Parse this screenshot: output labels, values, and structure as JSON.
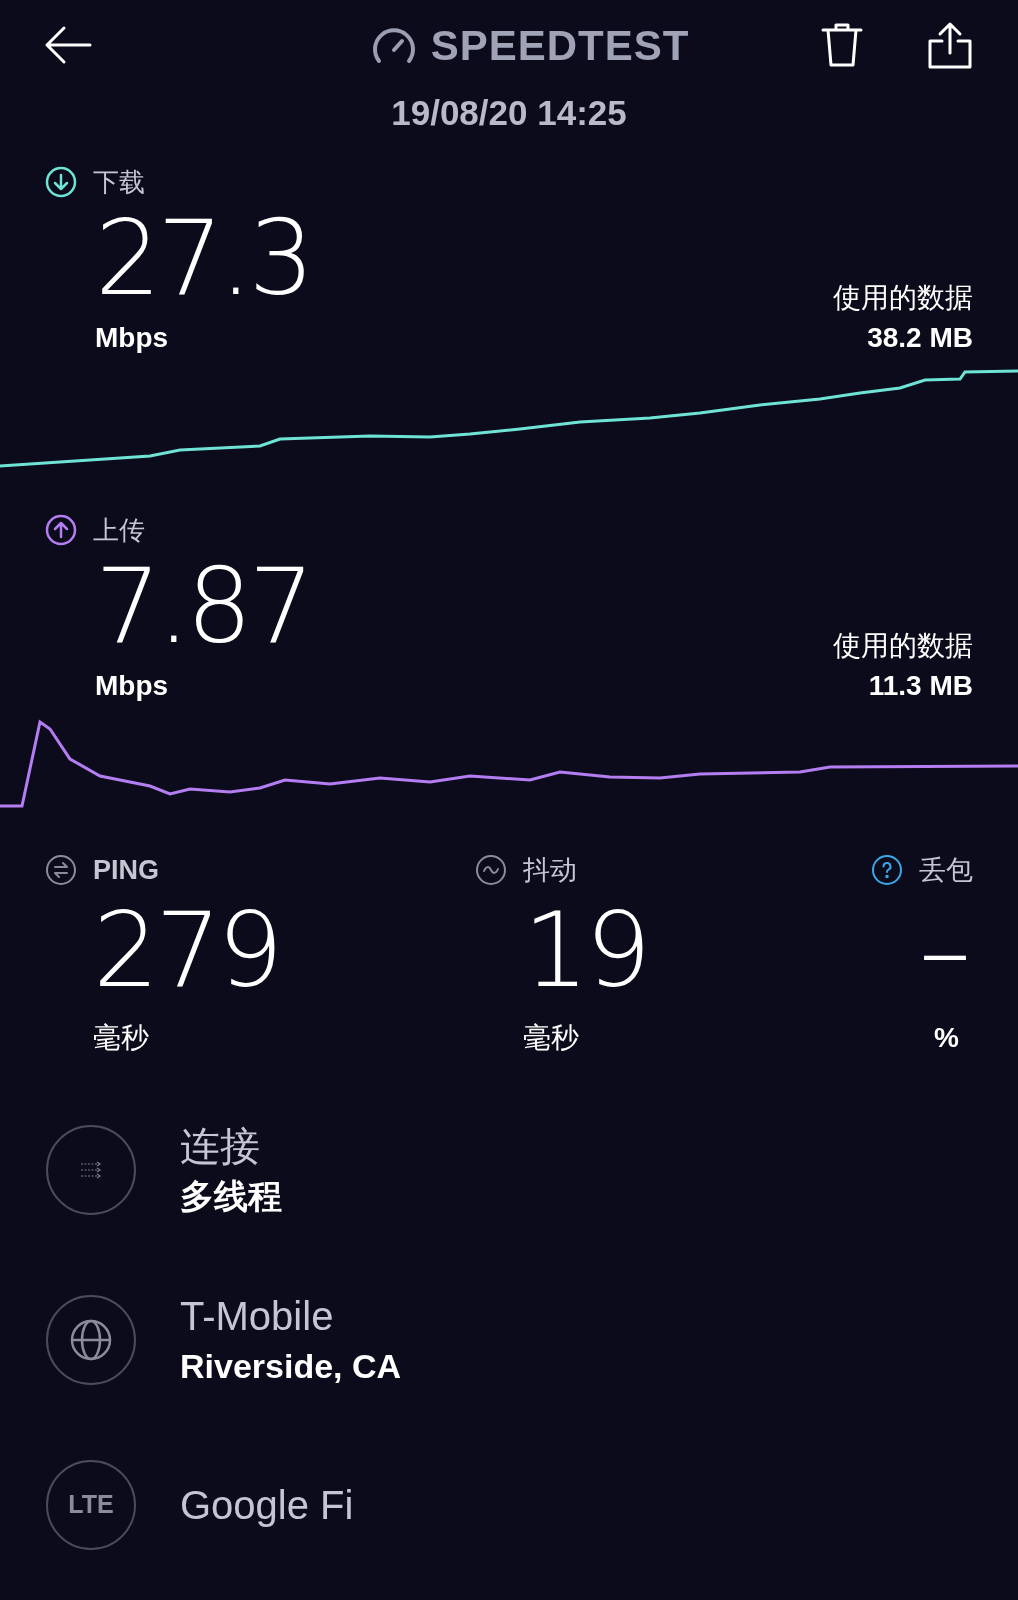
{
  "header": {
    "title": "SPEEDTEST",
    "datetime": "19/08/20 14:25"
  },
  "tests": [
    {
      "kind": "download",
      "label": "下载",
      "value": "27.3",
      "unit": "Mbps",
      "data_label": "使用的数据",
      "data_value": "38.2 MB"
    },
    {
      "kind": "upload",
      "label": "上传",
      "value": "7.87",
      "unit": "Mbps",
      "data_label": "使用的数据",
      "data_value": "11.3 MB"
    }
  ],
  "metrics": [
    {
      "kind": "ping",
      "label": "PING",
      "value": "279",
      "unit": "毫秒"
    },
    {
      "kind": "jitter",
      "label": "抖动",
      "value": "19",
      "unit": "毫秒"
    },
    {
      "kind": "loss",
      "label": "丢包",
      "value": "–",
      "unit": "%"
    }
  ],
  "details": [
    {
      "kind": "connections",
      "title": "连接",
      "subtitle": "多线程"
    },
    {
      "kind": "server",
      "title": "T-Mobile",
      "subtitle": "Riverside, CA"
    },
    {
      "kind": "provider",
      "badge": "LTE",
      "title": "Google Fi"
    }
  ]
}
